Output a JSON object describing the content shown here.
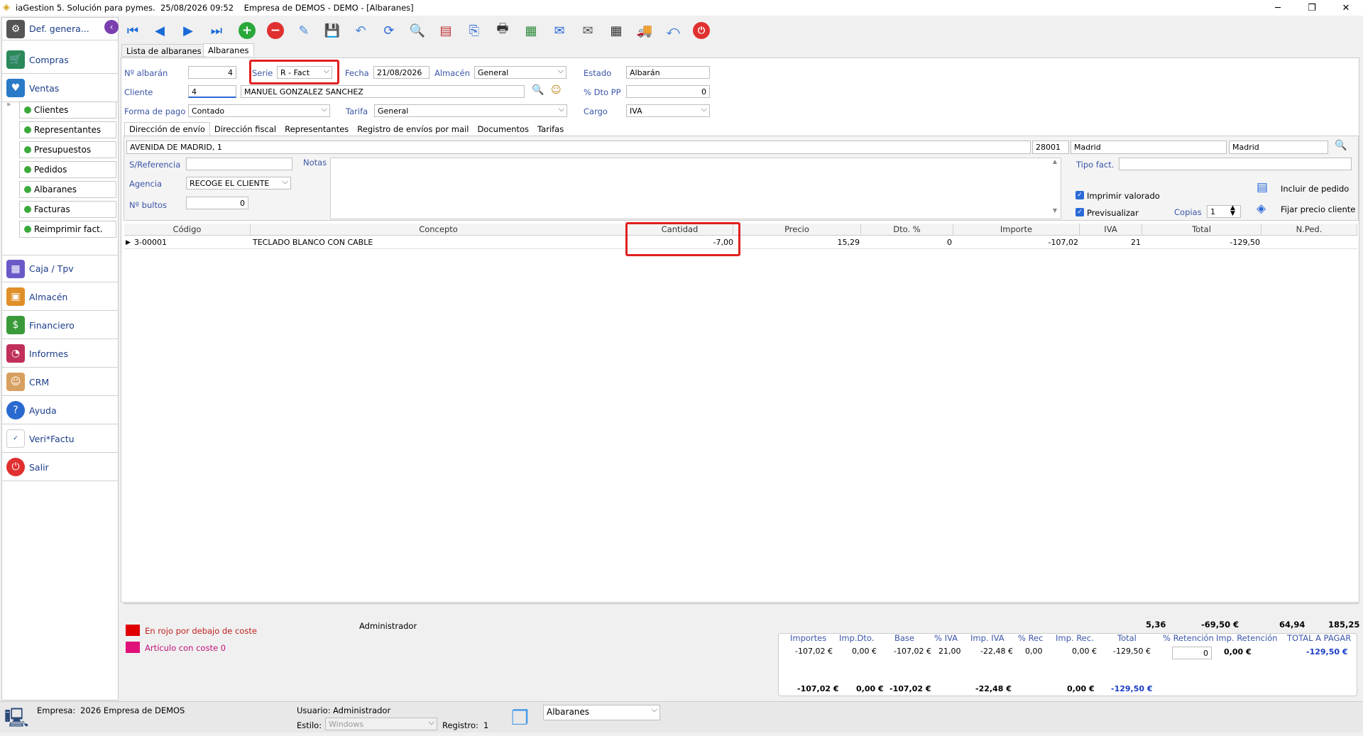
{
  "title": "iaGestion 5. Solución para pymes.  25/08/2026 09:52    Empresa de DEMOS - DEMO - [Albaranes]",
  "win": {
    "min": "─",
    "max": "❐",
    "close": "✕"
  },
  "sidebar": {
    "top_label": "Def. genera...",
    "items": [
      {
        "label": "Compras"
      },
      {
        "label": "Ventas"
      }
    ],
    "subitems": [
      {
        "label": "Clientes"
      },
      {
        "label": "Representantes"
      },
      {
        "label": "Presupuestos"
      },
      {
        "label": "Pedidos"
      },
      {
        "label": "Albaranes"
      },
      {
        "label": "Facturas"
      },
      {
        "label": "Reimprimir fact."
      }
    ],
    "modules": [
      {
        "label": "Caja / Tpv"
      },
      {
        "label": "Almacén"
      },
      {
        "label": "Financiero"
      },
      {
        "label": "Informes"
      },
      {
        "label": "CRM"
      },
      {
        "label": "Ayuda"
      },
      {
        "label": "Veri*Factu"
      },
      {
        "label": "Salir"
      }
    ]
  },
  "tabs": {
    "list": "Lista de albaranes",
    "detail": "Albaranes"
  },
  "header": {
    "n_albaran_label": "Nº albarán",
    "n_albaran": "4",
    "serie_label": "Serie",
    "serie": "R   - Fact",
    "fecha_label": "Fecha",
    "fecha": "21/08/2026",
    "almacen_label": "Almacén",
    "almacen": "General",
    "estado_label": "Estado",
    "estado": "Albarán",
    "cliente_label": "Cliente",
    "cliente_code": "4",
    "cliente_name": "MANUEL GONZALEZ SANCHEZ",
    "dto_pp_label": "% Dto PP",
    "dto_pp": "0",
    "forma_pago_label": "Forma de pago",
    "forma_pago": "Contado",
    "tarifa_label": "Tarifa",
    "tarifa": "General",
    "cargo_label": "Cargo",
    "cargo": "IVA"
  },
  "subtabs": [
    "Dirección de envío",
    "Dirección fiscal",
    "Representantes",
    "Registro de envíos por mail",
    "Documentos",
    "Tarifas"
  ],
  "address": {
    "street": "AVENIDA DE MADRID, 1",
    "cp": "28001",
    "city": "Madrid",
    "province": "Madrid"
  },
  "extra": {
    "sref_label": "S/Referencia",
    "sref": "",
    "notas_label": "Notas",
    "agencia_label": "Agencia",
    "agencia": "RECOGE EL CLIENTE",
    "bultos_label": "Nº bultos",
    "bultos": "0",
    "tipo_fact_label": "Tipo fact.",
    "imprimir_valorado": "Imprimir valorado",
    "previsualizar": "Previsualizar",
    "copias_label": "Copias",
    "copias": "1",
    "incluir_pedido": "Incluir de pedido",
    "fijar_precio": "Fijar precio cliente"
  },
  "grid": {
    "columns": [
      "Código",
      "Concepto",
      "Cantidad",
      "Precio",
      "Dto. %",
      "Importe",
      "IVA",
      "Total",
      "N.Ped."
    ],
    "rows": [
      {
        "codigo": "3-00001",
        "concepto": "TECLADO BLANCO CON CABLE",
        "cantidad": "-7,00",
        "precio": "15,29",
        "dto": "0",
        "importe": "-107,02",
        "iva": "21",
        "total": "-129,50",
        "nped": ""
      }
    ]
  },
  "legend": {
    "red": "En rojo por debajo de coste",
    "pink": "Artículo con coste 0",
    "red_color": "#e00000",
    "pink_color": "#e0107a"
  },
  "usuario_name": "Administrador",
  "summary_top": [
    "5,36",
    "-69,50 €",
    "64,94",
    "185,25"
  ],
  "totals": {
    "headers": [
      "Importes",
      "Imp.Dto.",
      "Base",
      "% IVA",
      "Imp. IVA",
      "% Rec",
      "Imp. Rec.",
      "Total",
      "% Retención",
      "Imp. Retención",
      "TOTAL A PAGAR"
    ],
    "row": [
      "-107,02 €",
      "0,00 €",
      "-107,02 €",
      "21,00",
      "-22,48 €",
      "0,00",
      "0,00 €",
      "-129,50 €",
      "0",
      "0,00 €",
      "-129,50 €"
    ],
    "footer": [
      "-107,02 €",
      "0,00 €",
      "-107,02 €",
      "-22,48 €",
      "0,00 €",
      "-129,50 €"
    ]
  },
  "status": {
    "empresa_label": "Empresa:",
    "empresa": "2026 Empresa de DEMOS",
    "usuario_label": "Usuario:",
    "usuario": "Administrador",
    "estilo_label": "Estilo:",
    "estilo": "Windows",
    "registro_label": "Registro:",
    "registro": "1",
    "module": "Albaranes"
  }
}
